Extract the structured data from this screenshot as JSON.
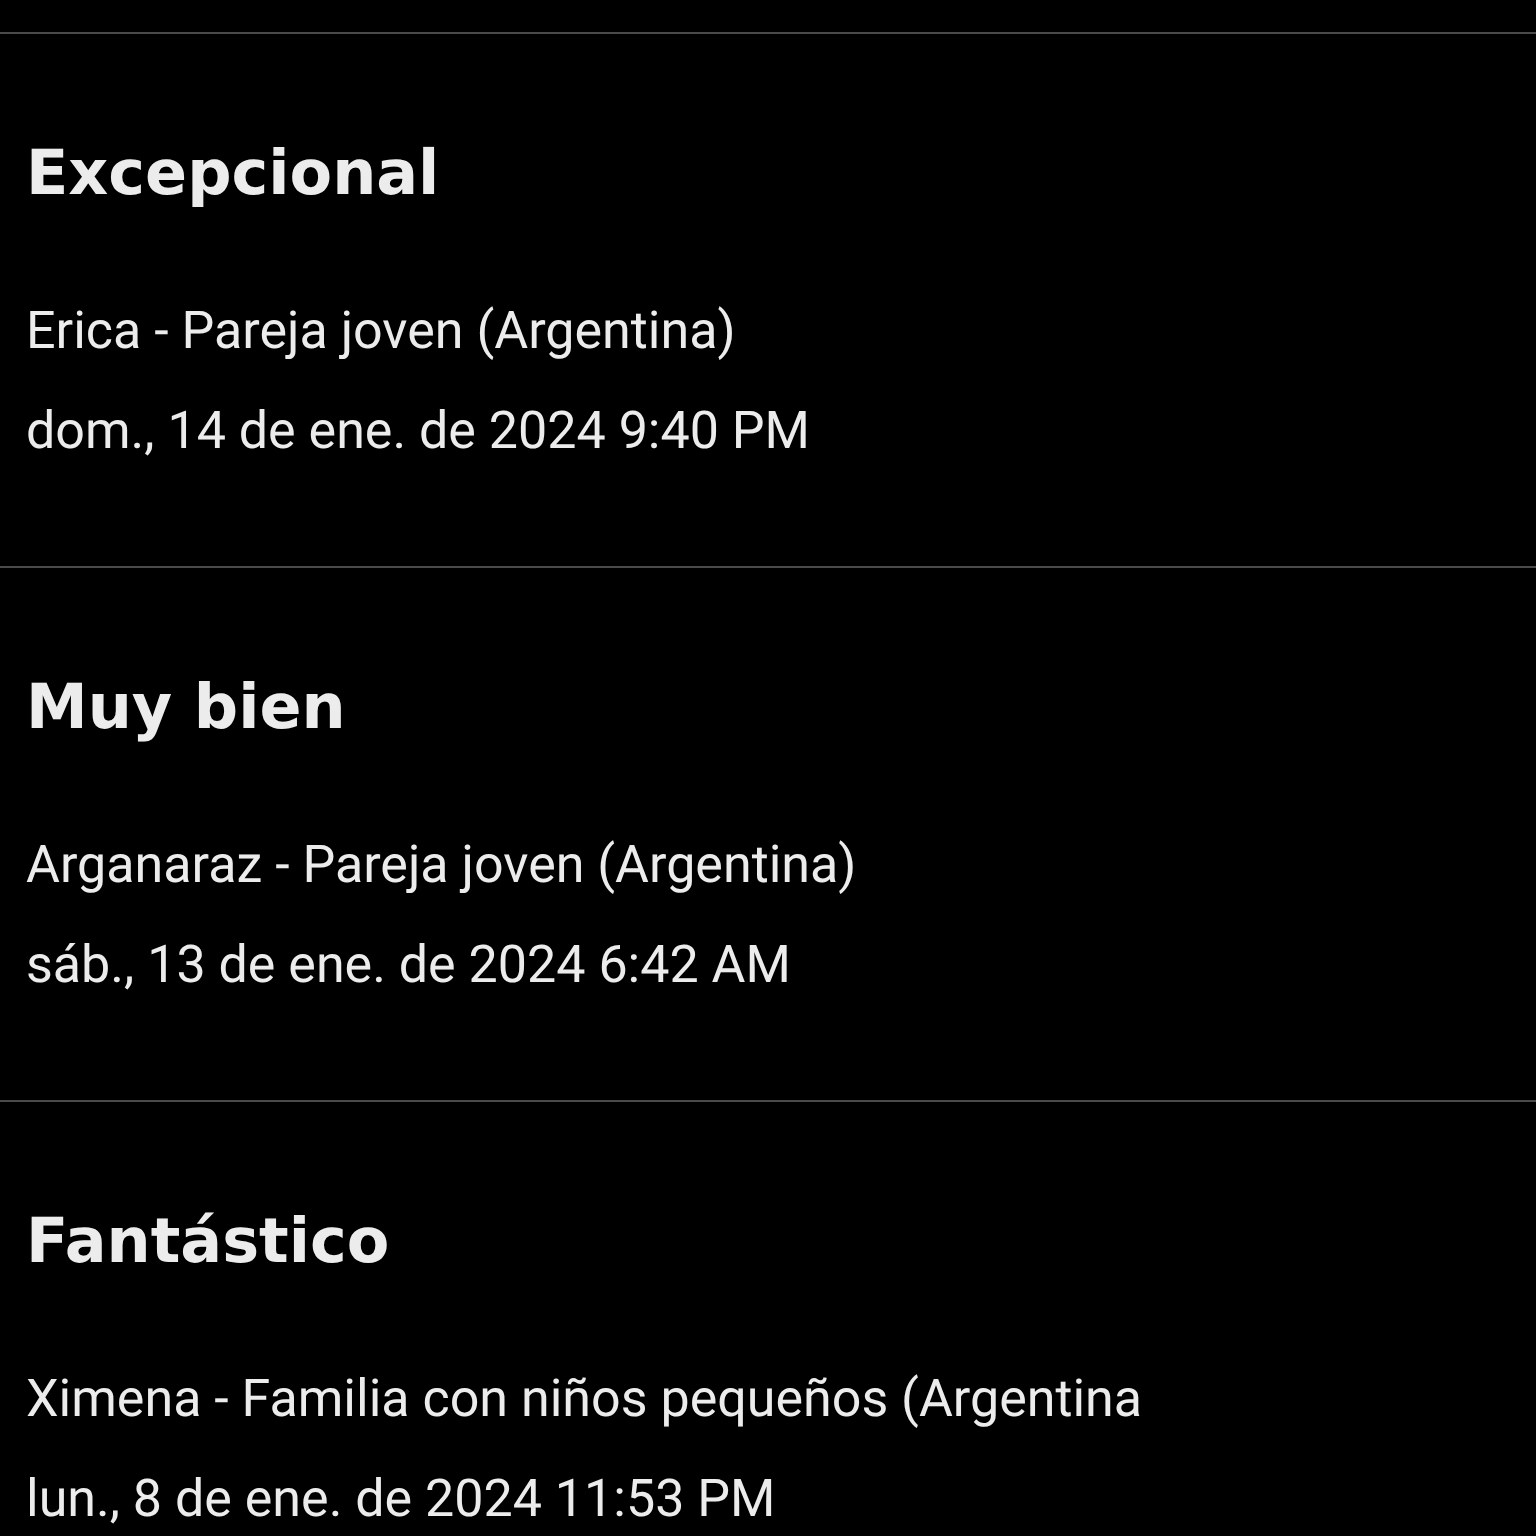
{
  "reviews": [
    {
      "rating": "Excepcional",
      "author": "Erica - Pareja joven (Argentina)",
      "date": "dom., 14 de ene. de 2024 9:40 PM"
    },
    {
      "rating": "Muy bien",
      "author": "Arganaraz - Pareja joven (Argentina)",
      "date": "sáb., 13 de ene. de 2024 6:42 AM"
    },
    {
      "rating": "Fantástico",
      "author": "Ximena - Familia con niños pequeños (Argentina",
      "date": "lun., 8 de ene. de 2024 11:53 PM"
    }
  ]
}
